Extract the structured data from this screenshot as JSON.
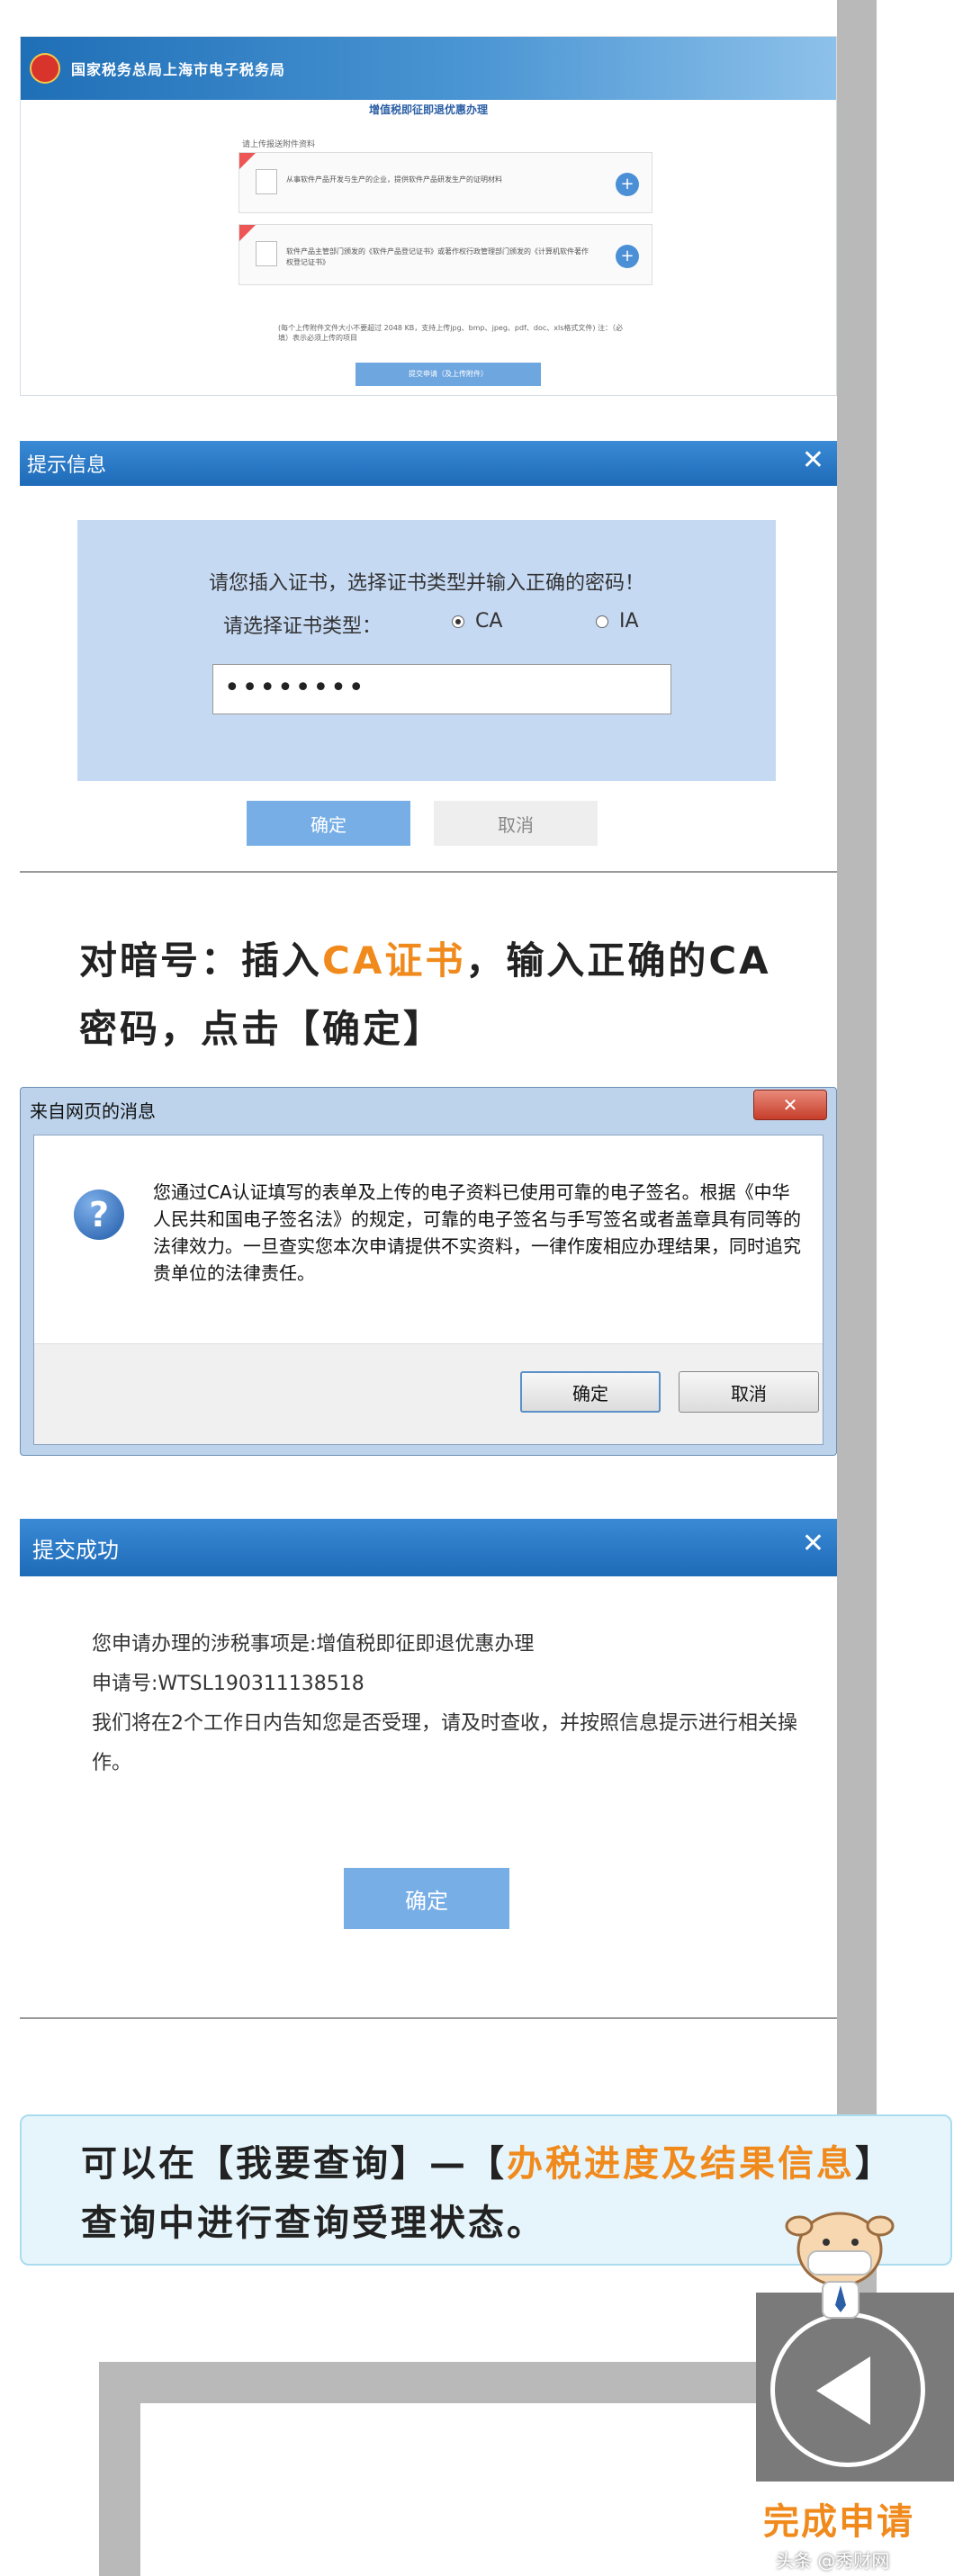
{
  "panel1": {
    "site_title": "国家税务总局上海市电子税务局",
    "heading": "增值税即征即退优惠办理",
    "upload_label": "请上传报送附件资料",
    "items": [
      {
        "text": "从事软件产品开发与生产的企业，提供软件产品研发生产的证明材料"
      },
      {
        "text": "软件产品主管部门颁发的《软件产品登记证书》或著作权行政管理部门颁发的《计算机软件著作权登记证书》"
      }
    ],
    "note": "(每个上传附件文件大小不要超过 2048 KB，支持上传jpg、bmp、jpeg、pdf、doc、xls格式文件) 注：（必填）表示必须上传的项目",
    "submit_label": "提交申请（及上传附件）"
  },
  "panel2": {
    "title": "提示信息",
    "message": "请您插入证书，选择证书类型并输入正确的密码！",
    "type_label": "请选择证书类型：",
    "radio_ca": "CA",
    "radio_ia": "IA",
    "password_mask": "••••••••",
    "ok_label": "确定",
    "cancel_label": "取消"
  },
  "caption1": {
    "part1": "对暗号：插入",
    "highlight": "CA证书",
    "part2": "，输入正确的CA密码，点击【确定】"
  },
  "panel3": {
    "title": "来自网页的消息",
    "close_glyph": "✕",
    "message": "您通过CA认证填写的表单及上传的电子资料已使用可靠的电子签名。根据《中华人民共和国电子签名法》的规定，可靠的电子签名与手写签名或者盖章具有同等的法律效力。一旦查实您本次申请提供不实资料，一律作废相应办理结果，同时追究贵单位的法律责任。",
    "ok_label": "确定",
    "cancel_label": "取消"
  },
  "panel4": {
    "title": "提交成功",
    "line1": "您申请办理的涉税事项是:增值税即征即退优惠办理",
    "line2": "申请号:WTSL190311138518",
    "line3": "我们将在2个工作日内告知您是否受理，请及时查收，并按照信息提示进行相关操作。",
    "ok_label": "确定"
  },
  "caption2": {
    "part1": "可以在【我要查询】—【",
    "highlight": "办税进度及结果信息",
    "part2": "】查询中进行查询受理状态。"
  },
  "bottom": {
    "label": "完成申请",
    "watermark": "头条 @秀财网"
  },
  "colors": {
    "accent_orange": "#f08a1c",
    "dialog_blue": "#1e6bb8",
    "button_blue": "#77aee6"
  }
}
